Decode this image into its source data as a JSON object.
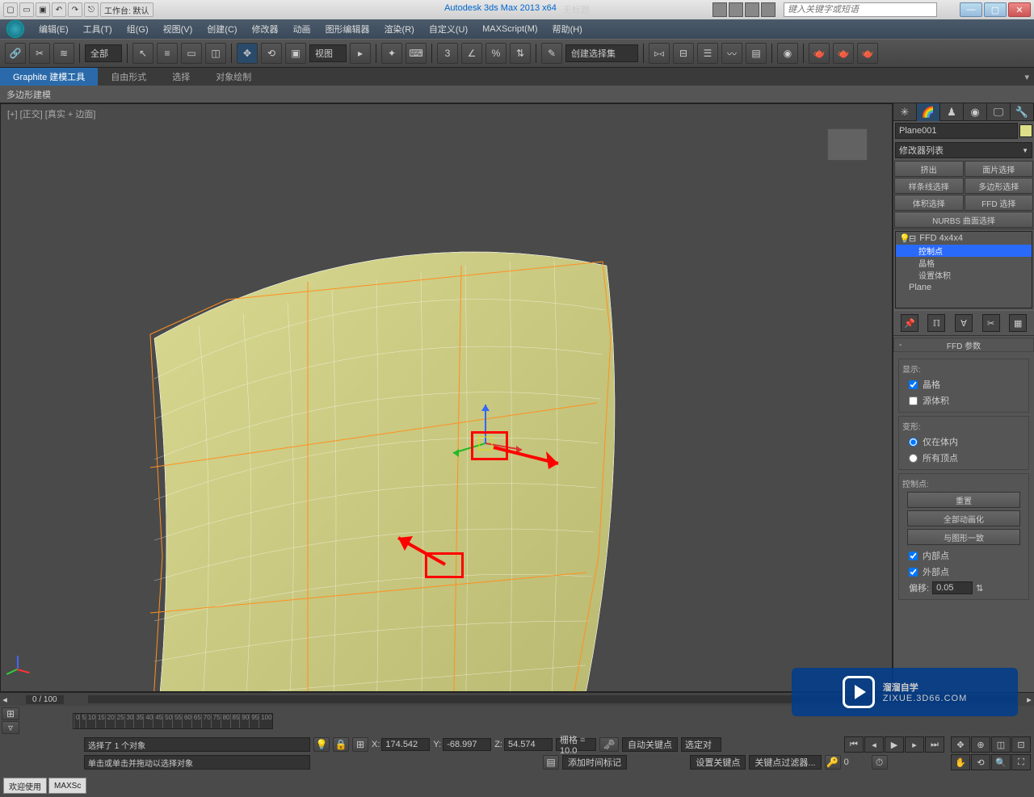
{
  "titlebar": {
    "workspace_label": "工作台: 默认",
    "app": "Autodesk 3ds Max  2013 x64",
    "doc": "无标题",
    "help_placeholder": "键入关键字或短语"
  },
  "menus": [
    "编辑(E)",
    "工具(T)",
    "组(G)",
    "视图(V)",
    "创建(C)",
    "修改器",
    "动画",
    "图形编辑器",
    "渲染(R)",
    "自定义(U)",
    "MAXScript(M)",
    "帮助(H)"
  ],
  "toolbar": {
    "sel_filter": "全部",
    "view_dd": "视图",
    "named_sel": "创建选择集"
  },
  "ribbon": {
    "tabs": [
      "Graphite 建模工具",
      "自由形式",
      "选择",
      "对象绘制"
    ],
    "sub": "多边形建模"
  },
  "viewport": {
    "label": "[+] [正交] [真实 + 边面]"
  },
  "sidebar": {
    "object_name": "Plane001",
    "modifier_dd": "修改器列表",
    "small_btns": [
      "挤出",
      "面片选择",
      "样条线选择",
      "多边形选择",
      "体积选择",
      "FFD 选择"
    ],
    "nurbs_btn": "NURBS 曲面选择",
    "stack": {
      "top": "FFD 4x4x4",
      "subs": [
        "控制点",
        "晶格",
        "设置体积"
      ],
      "base": "Plane"
    },
    "rollout_title": "FFD 参数",
    "display_group": "显示:",
    "chk_lattice": "晶格",
    "chk_source": "源体积",
    "deform_group": "变形:",
    "rad_inside": "仅在体内",
    "rad_allverts": "所有顶点",
    "cp_group": "控制点:",
    "btn_reset": "重置",
    "btn_animall": "全部动画化",
    "btn_conform": "与图形一致",
    "chk_inside": "内部点",
    "chk_outside": "外部点",
    "offset_label": "偏移:",
    "offset_val": "0.05"
  },
  "timeline": {
    "frame_pos": "0 / 100",
    "ticks": [
      "0",
      "5",
      "10",
      "15",
      "20",
      "25",
      "30",
      "35",
      "40",
      "45",
      "50",
      "55",
      "60",
      "65",
      "70",
      "75",
      "80",
      "85",
      "90",
      "95",
      "100"
    ]
  },
  "status": {
    "sel_msg": "选择了 1 个对象",
    "prompt": "单击或单击并拖动以选择对象",
    "x_label": "X:",
    "x": "174.542",
    "y_label": "Y:",
    "y": "-68.997",
    "z_label": "Z:",
    "z": "54.574",
    "grid_label": "栅格 = 10.0",
    "autokey": "自动关键点",
    "setkey": "设置关键点",
    "keyfilter": "关键点过滤器...",
    "selected_lbl": "选定对",
    "addtime": "添加时间标记"
  },
  "welcome": {
    "tab1": "欢迎使用",
    "tab2": "MAXSc"
  },
  "watermark": {
    "main": "溜溜自学",
    "sub": "ZIXUE.3D66.COM"
  }
}
